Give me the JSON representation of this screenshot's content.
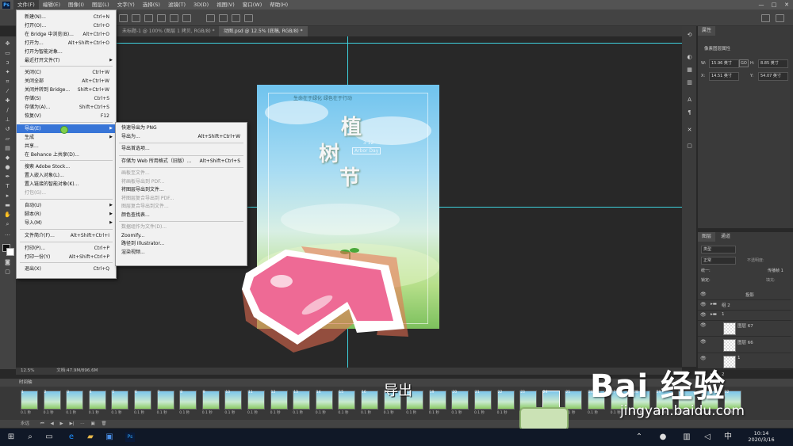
{
  "menubar": {
    "items": [
      "文件(F)",
      "编辑(E)",
      "图像(I)",
      "图层(L)",
      "文字(Y)",
      "选择(S)",
      "滤镜(T)",
      "3D(D)",
      "视图(V)",
      "窗口(W)",
      "帮助(H)"
    ],
    "win_controls": [
      "—",
      "□",
      "✕"
    ]
  },
  "tabs": [
    {
      "label": "未标题-1 @ 100% (图层 1 拷贝, RGB/8) *",
      "active": false
    },
    {
      "label": "动图.psd @ 12.5% (底稿, RGB/8) *",
      "active": true
    }
  ],
  "file_menu": {
    "items": [
      {
        "label": "新建(N)...",
        "shortcut": "Ctrl+N"
      },
      {
        "label": "打开(O)...",
        "shortcut": "Ctrl+O"
      },
      {
        "label": "在 Bridge 中浏览(B)...",
        "shortcut": "Alt+Ctrl+O"
      },
      {
        "label": "打开为...",
        "shortcut": "Alt+Shift+Ctrl+O"
      },
      {
        "label": "打开为智能对象...",
        "shortcut": ""
      },
      {
        "label": "最近打开文件(T)",
        "shortcut": "",
        "submenu": true
      },
      {
        "sep": true
      },
      {
        "label": "关闭(C)",
        "shortcut": "Ctrl+W"
      },
      {
        "label": "关闭全部",
        "shortcut": "Alt+Ctrl+W"
      },
      {
        "label": "关闭并转到 Bridge...",
        "shortcut": "Shift+Ctrl+W"
      },
      {
        "label": "存储(S)",
        "shortcut": "Ctrl+S"
      },
      {
        "label": "存储为(A)...",
        "shortcut": "Shift+Ctrl+S"
      },
      {
        "label": "恢复(V)",
        "shortcut": "F12"
      },
      {
        "sep": true
      },
      {
        "label": "导出(E)",
        "shortcut": "",
        "submenu": true,
        "highlight": true
      },
      {
        "label": "生成",
        "shortcut": "",
        "submenu": true
      },
      {
        "label": "共享...",
        "shortcut": ""
      },
      {
        "label": "在 Behance 上共享(D)...",
        "shortcut": ""
      },
      {
        "sep": true
      },
      {
        "label": "搜索 Adobe Stock...",
        "shortcut": ""
      },
      {
        "label": "置入嵌入对象(L)...",
        "shortcut": ""
      },
      {
        "label": "置入链接的智能对象(K)...",
        "shortcut": ""
      },
      {
        "label": "打包(G)...",
        "shortcut": "",
        "disabled": true
      },
      {
        "sep": true
      },
      {
        "label": "自动(U)",
        "shortcut": "",
        "submenu": true
      },
      {
        "label": "脚本(R)",
        "shortcut": "",
        "submenu": true
      },
      {
        "label": "导入(M)",
        "shortcut": "",
        "submenu": true
      },
      {
        "sep": true
      },
      {
        "label": "文件简介(F)...",
        "shortcut": "Alt+Shift+Ctrl+I"
      },
      {
        "sep": true
      },
      {
        "label": "打印(P)...",
        "shortcut": "Ctrl+P"
      },
      {
        "label": "打印一份(Y)",
        "shortcut": "Alt+Shift+Ctrl+P"
      },
      {
        "sep": true
      },
      {
        "label": "退出(X)",
        "shortcut": "Ctrl+Q"
      }
    ]
  },
  "export_submenu": {
    "items": [
      {
        "label": "快速导出为 PNG",
        "shortcut": ""
      },
      {
        "label": "导出为...",
        "shortcut": "Alt+Shift+Ctrl+W"
      },
      {
        "sep": true
      },
      {
        "label": "导出首选项...",
        "shortcut": ""
      },
      {
        "sep": true
      },
      {
        "label": "存储为 Web 所用格式（旧版）...",
        "shortcut": "Alt+Shift+Ctrl+S"
      },
      {
        "sep": true
      },
      {
        "label": "画板至文件...",
        "shortcut": "",
        "disabled": true
      },
      {
        "label": "将画板导出到 PDF...",
        "shortcut": "",
        "disabled": true
      },
      {
        "label": "将图层导出到文件...",
        "shortcut": ""
      },
      {
        "label": "将图层复合导出到 PDF...",
        "shortcut": "",
        "disabled": true
      },
      {
        "label": "图层复合导出到文件...",
        "shortcut": "",
        "disabled": true
      },
      {
        "label": "颜色查找表...",
        "shortcut": ""
      },
      {
        "sep": true
      },
      {
        "label": "数据组作为文件(D)...",
        "shortcut": "",
        "disabled": true
      },
      {
        "label": "Zoomify...",
        "shortcut": ""
      },
      {
        "label": "路径到 Illustrator...",
        "shortcut": ""
      },
      {
        "label": "渲染视频...",
        "shortcut": ""
      }
    ]
  },
  "poster": {
    "top_text": "生命在于绿化   绿色在于行动",
    "title_1": "植",
    "title_2": "树",
    "title_3": "节",
    "date": "3·12",
    "sub": "Arbor Day"
  },
  "properties": {
    "tab": "属性",
    "heading": "像素图层属性",
    "w_label": "W:",
    "w_value": "15.96 英寸",
    "h_label": "H:",
    "h_value": "8.85 英寸",
    "x_label": "X:",
    "x_value": "14.51 英寸",
    "y_label": "Y:",
    "y_value": "54.07 英寸",
    "link": "GO"
  },
  "layers": {
    "tabs": [
      "图层",
      "通道"
    ],
    "filter": "类型",
    "blend": "正常",
    "opacity_label": "不透明度:",
    "lock_label": "锁定:",
    "unify": "统一:",
    "propagate": "传播帧 1",
    "fill_label": "填充:",
    "rows": [
      {
        "name": "投影",
        "type": "fx"
      },
      {
        "name": "组 2",
        "type": "group"
      },
      {
        "name": "1",
        "type": "group"
      },
      {
        "name": "图层 67",
        "type": "layer"
      },
      {
        "name": "图层 66",
        "type": "layer"
      },
      {
        "name": "1",
        "type": "layer"
      },
      {
        "name": "2",
        "type": "group"
      }
    ]
  },
  "status": {
    "zoom": "12.5%",
    "doc": "文档:47.9M/896.6M"
  },
  "timeline": {
    "title": "时间轴",
    "loop": "永远",
    "frames": [
      "1",
      "2",
      "3",
      "4",
      "5",
      "6",
      "7",
      "8",
      "9",
      "10",
      "11",
      "12",
      "13",
      "14",
      "15",
      "16",
      "17",
      "18",
      "19",
      "20",
      "21",
      "22",
      "23",
      "24",
      "25",
      "26",
      "27",
      "28",
      "29",
      "30",
      "31",
      "32"
    ],
    "duration": "0.1 秒",
    "selected_frame": "24"
  },
  "subtitle": "导出",
  "watermark": {
    "logo": "Bai 经验",
    "url": "jingyan.baidu.com"
  },
  "taskbar": {
    "time": "10:14",
    "date": "2020/3/16"
  }
}
